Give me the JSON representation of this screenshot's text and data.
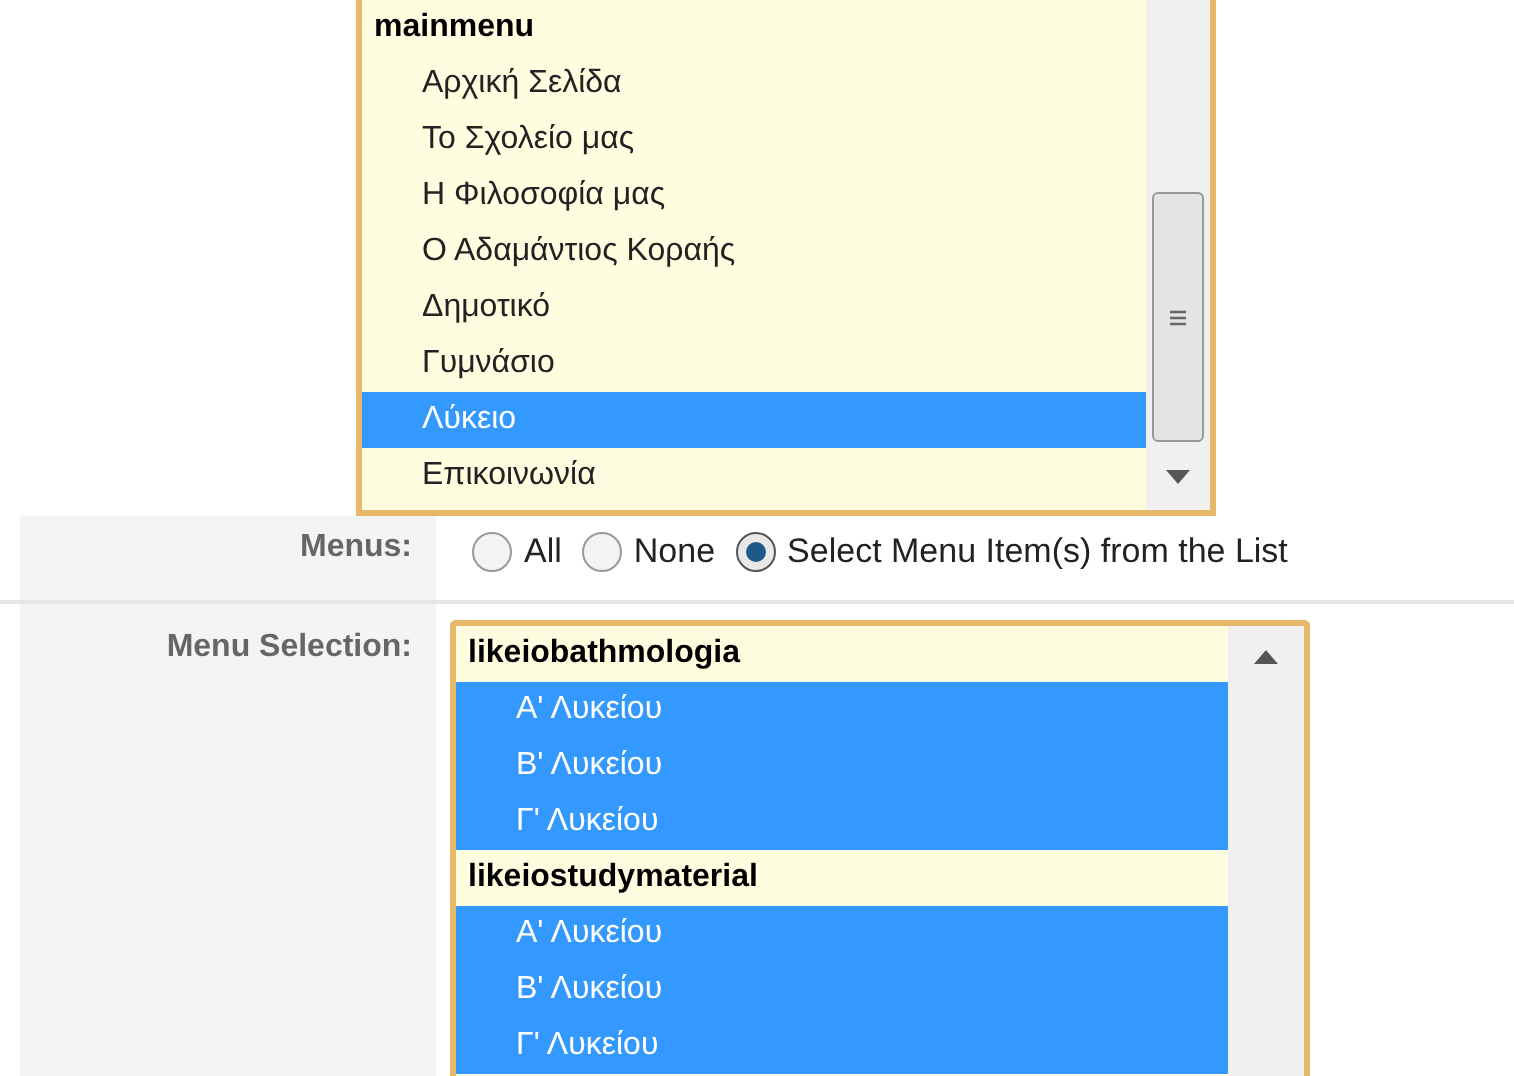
{
  "menu_list": {
    "group": "mainmenu",
    "items": [
      {
        "label": "Αρχική Σελίδα",
        "selected": false
      },
      {
        "label": "Το Σχολείο μας",
        "selected": false
      },
      {
        "label": "Η Φιλοσοφία μας",
        "selected": false
      },
      {
        "label": "Ο Αδαμάντιος Κοραής",
        "selected": false
      },
      {
        "label": "Δημοτικό",
        "selected": false
      },
      {
        "label": "Γυμνάσιο",
        "selected": false
      },
      {
        "label": "Λύκειο",
        "selected": true
      },
      {
        "label": "Επικοινωνία",
        "selected": false
      }
    ]
  },
  "menus": {
    "label": "Menus:",
    "options": [
      {
        "label": "All",
        "selected": false
      },
      {
        "label": "None",
        "selected": false
      },
      {
        "label": "Select Menu Item(s) from the List",
        "selected": true
      }
    ]
  },
  "menu_selection": {
    "label": "Menu Selection:",
    "groups": [
      {
        "name": "likeiobathmologia",
        "items": [
          {
            "label": "Α' Λυκείου",
            "selected": true
          },
          {
            "label": "Β' Λυκείου",
            "selected": true
          },
          {
            "label": "Γ' Λυκείου",
            "selected": true
          }
        ]
      },
      {
        "name": "likeiostudymaterial",
        "items": [
          {
            "label": "Α' Λυκείου",
            "selected": true
          },
          {
            "label": "Β' Λυκείου",
            "selected": true
          },
          {
            "label": "Γ' Λυκείου",
            "selected": true
          }
        ]
      }
    ]
  }
}
